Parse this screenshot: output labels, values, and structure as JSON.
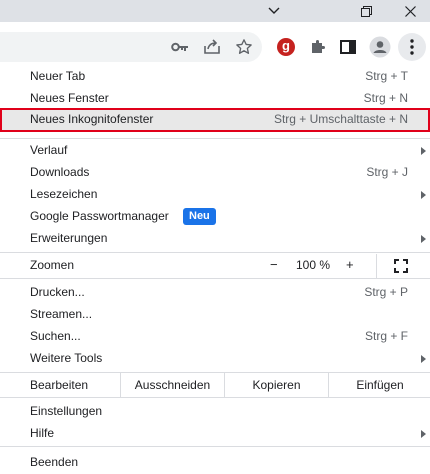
{
  "window": {
    "icons": [
      "chevron-down-icon",
      "restore-icon",
      "close-icon"
    ]
  },
  "toolbar": {
    "profile_letter": "g",
    "icons": [
      "key-icon",
      "share-icon",
      "star-icon",
      "profile-g-icon",
      "puzzle-icon",
      "sidepanel-icon",
      "account-icon",
      "kebab-icon"
    ]
  },
  "menu": {
    "new_tab": {
      "label": "Neuer Tab",
      "shortcut": "Strg + T"
    },
    "new_window": {
      "label": "Neues Fenster",
      "shortcut": "Strg + N"
    },
    "incognito": {
      "label": "Neues Inkognitofenster",
      "shortcut": "Strg + Umschalttaste + N"
    },
    "history": {
      "label": "Verlauf"
    },
    "downloads": {
      "label": "Downloads",
      "shortcut": "Strg + J"
    },
    "bookmarks": {
      "label": "Lesezeichen"
    },
    "passwords": {
      "label": "Google Passwortmanager",
      "badge": "Neu"
    },
    "extensions": {
      "label": "Erweiterungen"
    },
    "zoom": {
      "label": "Zoomen",
      "minus": "−",
      "value": "100 %",
      "plus": "+"
    },
    "print": {
      "label": "Drucken...",
      "shortcut": "Strg + P"
    },
    "cast": {
      "label": "Streamen..."
    },
    "find": {
      "label": "Suchen...",
      "shortcut": "Strg + F"
    },
    "more_tools": {
      "label": "Weitere Tools"
    },
    "edit": {
      "label": "Bearbeiten",
      "cut": "Ausschneiden",
      "copy": "Kopieren",
      "paste": "Einfügen"
    },
    "settings": {
      "label": "Einstellungen"
    },
    "help": {
      "label": "Hilfe"
    },
    "exit": {
      "label": "Beenden"
    }
  }
}
